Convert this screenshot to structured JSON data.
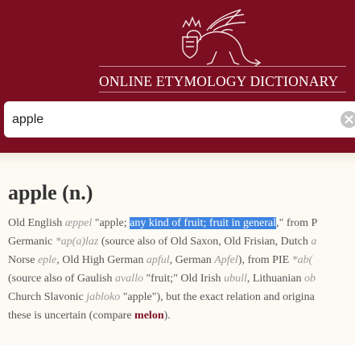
{
  "site": {
    "title": "ONLINE ETYMOLOGY DICTIONARY"
  },
  "search": {
    "value": "apple",
    "placeholder": ""
  },
  "entry": {
    "word": "apple (n.)",
    "lines": [
      [
        {
          "t": "Old English "
        },
        {
          "t": "æppel",
          "c": "foreign"
        },
        {
          "t": " \"apple; "
        },
        {
          "t": "any kind of fruit; fruit in general",
          "c": "hl"
        },
        {
          "t": ",\" from P"
        }
      ],
      [
        {
          "t": "Germanic "
        },
        {
          "t": "*ap(a)laz",
          "c": "foreign"
        },
        {
          "t": " (source also of Old Saxon, Old Frisian, Dutch "
        },
        {
          "t": "a",
          "c": "foreign"
        }
      ],
      [
        {
          "t": "Norse "
        },
        {
          "t": "eple",
          "c": "foreign"
        },
        {
          "t": ", Old High German "
        },
        {
          "t": "apful",
          "c": "foreign"
        },
        {
          "t": ", German "
        },
        {
          "t": "Apfel",
          "c": "foreign"
        },
        {
          "t": "), from PIE "
        },
        {
          "t": "*ab(",
          "c": "foreign"
        }
      ],
      [
        {
          "t": "(source also of Gaulish "
        },
        {
          "t": "avallo",
          "c": "foreign"
        },
        {
          "t": " \"fruit;\" Old Irish "
        },
        {
          "t": "ubull",
          "c": "foreign"
        },
        {
          "t": ", Lithuanian "
        },
        {
          "t": "ob",
          "c": "foreign"
        }
      ],
      [
        {
          "t": "Church Slavonic "
        },
        {
          "t": "jabloko",
          "c": "foreign"
        },
        {
          "t": " \"apple\"), but the exact relation and origina"
        }
      ],
      [
        {
          "t": "these is uncertain (compare "
        },
        {
          "t": "melon",
          "c": "xref"
        },
        {
          "t": ")."
        }
      ]
    ]
  },
  "colors": {
    "header": "#7c0e22",
    "page_bg": "#fdfaf4",
    "highlight": "#3e84e0",
    "xref": "#7c0e22"
  },
  "icons": [
    "wyvern-logo-icon",
    "clear-search-icon"
  ]
}
